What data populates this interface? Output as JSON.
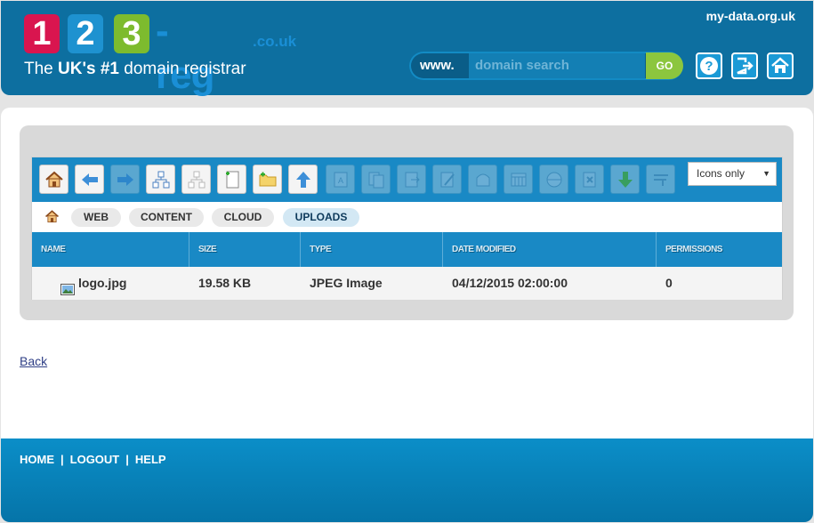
{
  "header": {
    "logo": {
      "digits": [
        "1",
        "2",
        "3"
      ],
      "reg": "-reg",
      "couk": ".co.uk"
    },
    "tagline_pre": "The ",
    "tagline_bold": "UK's #1",
    "tagline_post": " domain registrar",
    "site_name": "my-data.org.uk",
    "search": {
      "prefix": "www.",
      "placeholder": "domain search",
      "go_label": "GO"
    },
    "icons": [
      "help-icon",
      "logout-icon",
      "home-icon"
    ]
  },
  "file_manager": {
    "toolbar_icons": [
      "home-icon",
      "back-arrow-icon",
      "forward-arrow-icon",
      "copy-tree-icon",
      "paste-tree-icon",
      "new-file-icon",
      "new-folder-icon",
      "upload-icon",
      "rename-icon",
      "duplicate-icon",
      "move-icon",
      "edit-file-icon",
      "archive-icon",
      "calculator-icon",
      "web-icon",
      "delete-icon",
      "download-icon",
      "extract-icon"
    ],
    "view_select": "Icons only",
    "tabs": [
      "WEB",
      "CONTENT",
      "CLOUD",
      "UPLOADS"
    ],
    "active_tab": "UPLOADS",
    "columns": [
      "NAME",
      "SIZE",
      "TYPE",
      "DATE MODIFIED",
      "PERMISSIONS"
    ],
    "rows": [
      {
        "name": "logo.jpg",
        "size": "19.58 KB",
        "type": "JPEG Image",
        "date": "04/12/2015 02:00:00",
        "permissions": "0"
      }
    ]
  },
  "back_link": "Back",
  "footer": {
    "links": [
      "HOME",
      "LOGOUT",
      "HELP"
    ],
    "separator": "|"
  },
  "colors": {
    "header_bg": "#0d6fa0",
    "accent": "#1989c5",
    "go_green": "#8cc63e",
    "logo_red": "#d9154f",
    "logo_blue": "#1e92d0",
    "logo_green": "#7dbb2e"
  }
}
